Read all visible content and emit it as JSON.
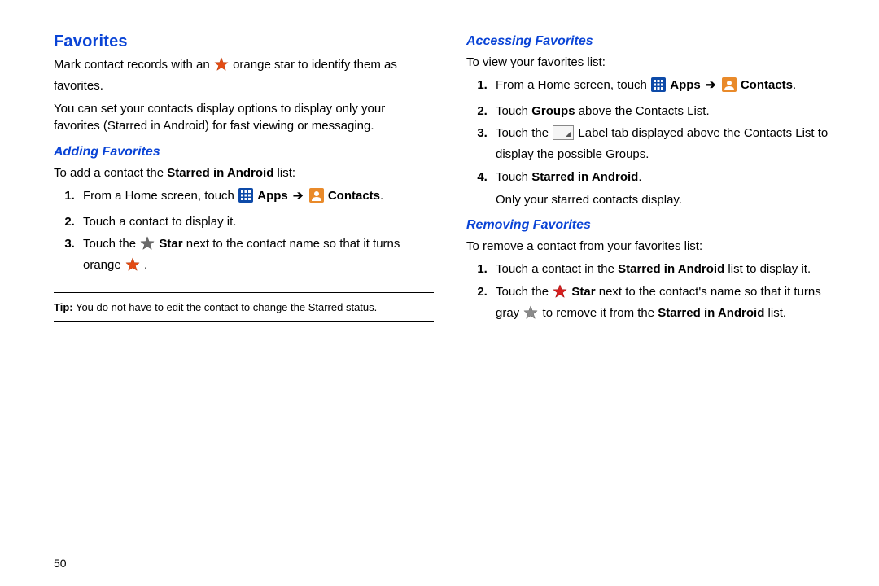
{
  "page_number": "50",
  "left": {
    "heading": "Favorites",
    "p1_a": "Mark contact records with an ",
    "p1_b": " orange star to identify them as favorites.",
    "p2": "You can set your contacts display options to display only your favorites (Starred in Android) for fast viewing or messaging.",
    "sub1": "Adding Favorites",
    "add_intro_a": "To add a contact the ",
    "add_intro_b": "Starred in Android",
    "add_intro_c": " list:",
    "s1_a": "From a Home screen, touch ",
    "s1_apps": "Apps",
    "s1_arrow": "➔",
    "s1_contacts": "Contacts",
    "s1_dot": ".",
    "s2": "Touch a contact to display it.",
    "s3_a": "Touch the ",
    "s3_star": "Star",
    "s3_b": " next to the contact name so that it turns orange ",
    "s3_dot": ".",
    "tip_label": "Tip:",
    "tip": " You do not have to edit the contact to change the Starred status."
  },
  "right": {
    "sub1": "Accessing Favorites",
    "acc_intro": "To view your favorites list:",
    "a1_a": "From a Home screen, touch ",
    "a1_apps": "Apps",
    "a1_arrow": "➔",
    "a1_contacts": "Contacts",
    "a1_dot": ".",
    "a2_a": "Touch ",
    "a2_b": "Groups",
    "a2_c": " above the Contacts List.",
    "a3_a": "Touch the ",
    "a3_b": " Label tab displayed above the Contacts List to display the possible Groups.",
    "a4_a": "Touch ",
    "a4_b": "Starred in Android",
    "a4_c": ".",
    "a4_note": "Only your starred contacts display.",
    "sub2": "Removing Favorites",
    "rem_intro": "To remove a contact from your favorites list:",
    "r1_a": "Touch a contact in the ",
    "r1_b": "Starred in Android",
    "r1_c": " list to display it.",
    "r2_a": "Touch the ",
    "r2_star": "Star",
    "r2_b": " next to the contact's name so that it turns gray ",
    "r2_c": " to remove it from the ",
    "r2_d": "Starred in Android",
    "r2_e": " list."
  }
}
